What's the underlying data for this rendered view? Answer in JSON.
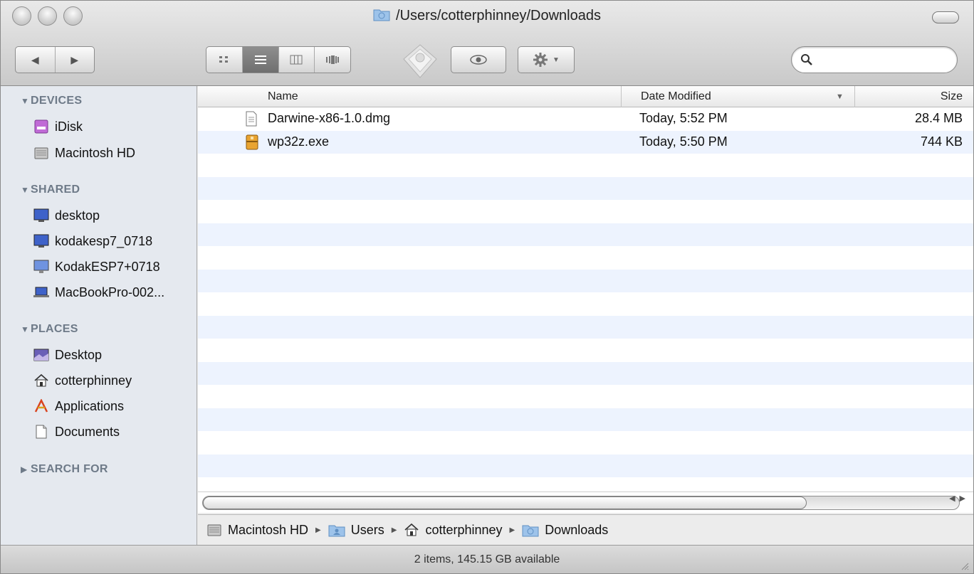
{
  "window": {
    "title": "/Users/cotterphinney/Downloads"
  },
  "toolbar": {
    "back_icon": "back-arrow-icon",
    "forward_icon": "forward-arrow-icon",
    "views": [
      "icon-view",
      "list-view",
      "column-view",
      "coverflow-view"
    ],
    "active_view": "list-view",
    "search_placeholder": ""
  },
  "sidebar": {
    "sections": [
      {
        "label": "DEVICES",
        "items": [
          {
            "label": "iDisk",
            "icon": "idisk-icon"
          },
          {
            "label": "Macintosh HD",
            "icon": "hard-drive-icon"
          }
        ]
      },
      {
        "label": "SHARED",
        "items": [
          {
            "label": "desktop",
            "icon": "monitor-icon"
          },
          {
            "label": "kodakesp7_0718",
            "icon": "monitor-icon"
          },
          {
            "label": "KodakESP7+0718",
            "icon": "monitor-icon"
          },
          {
            "label": "MacBookPro-002...",
            "icon": "laptop-icon"
          }
        ]
      },
      {
        "label": "PLACES",
        "items": [
          {
            "label": "Desktop",
            "icon": "desktop-folder-icon"
          },
          {
            "label": "cotterphinney",
            "icon": "home-icon"
          },
          {
            "label": "Applications",
            "icon": "applications-icon"
          },
          {
            "label": "Documents",
            "icon": "documents-icon"
          }
        ]
      },
      {
        "label": "SEARCH FOR",
        "collapsed": true
      }
    ]
  },
  "list": {
    "columns": {
      "name": "Name",
      "date": "Date Modified",
      "size": "Size"
    },
    "sort_column": "Date Modified",
    "rows": [
      {
        "name": "Darwine-x86-1.0.dmg",
        "date": "Today, 5:52 PM",
        "size": "28.4 MB",
        "icon": "disk-image-icon"
      },
      {
        "name": "wp32z.exe",
        "date": "Today, 5:50 PM",
        "size": "744 KB",
        "icon": "executable-icon"
      }
    ]
  },
  "pathbar": {
    "items": [
      {
        "label": "Macintosh HD",
        "icon": "hard-drive-icon"
      },
      {
        "label": "Users",
        "icon": "users-folder-icon"
      },
      {
        "label": "cotterphinney",
        "icon": "home-icon"
      },
      {
        "label": "Downloads",
        "icon": "downloads-folder-icon"
      }
    ]
  },
  "status": {
    "text": "2 items, 145.15 GB available"
  },
  "colors": {
    "sidebar_bg": "#e5e9ef",
    "sidebar_header": "#6e7a88",
    "row_stripe": "#edf3fe"
  }
}
